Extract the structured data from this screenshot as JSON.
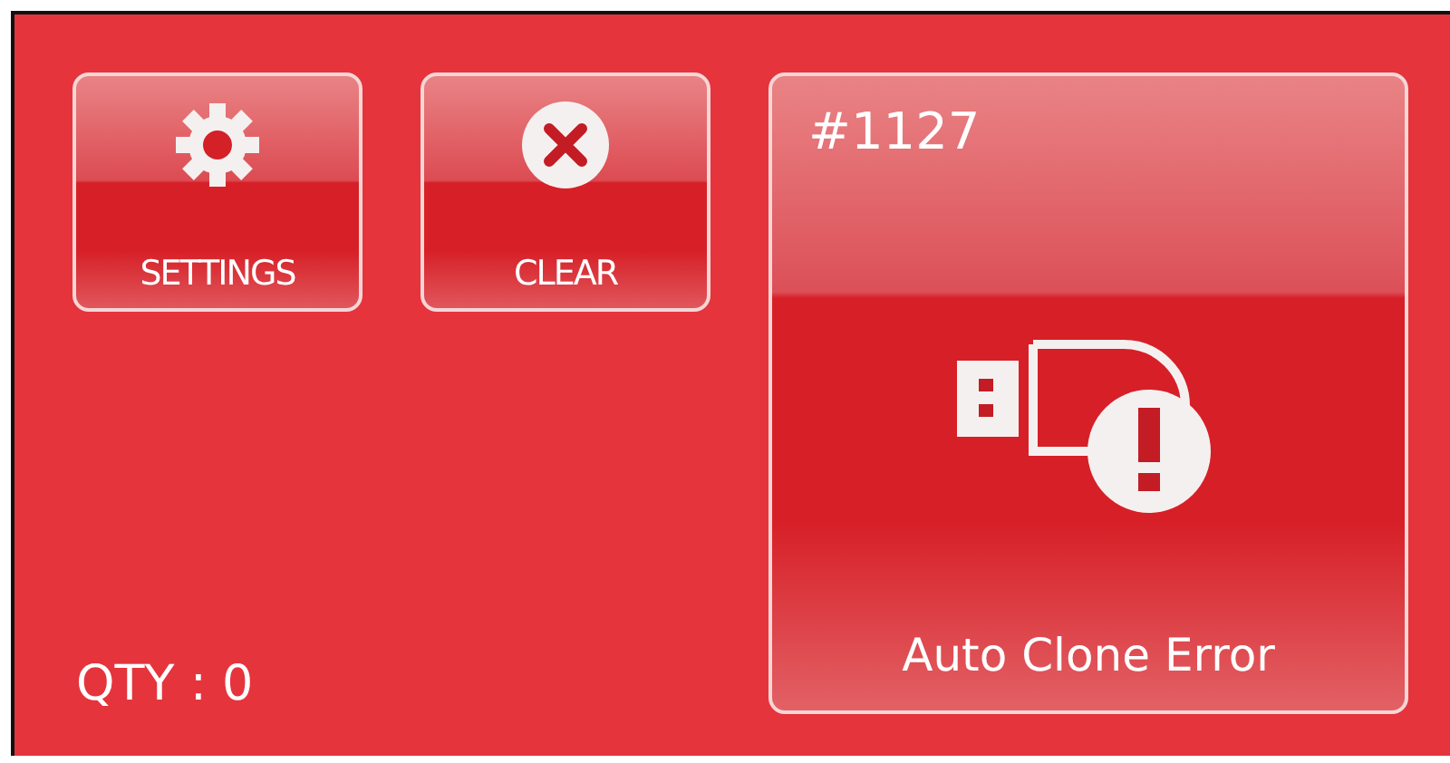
{
  "buttons": [
    {
      "kind": "settings",
      "label": "SETTINGS"
    },
    {
      "kind": "clear",
      "label": "CLEAR"
    }
  ],
  "quantity": "QTY : 0",
  "status_tile": {
    "number": "#1127",
    "kind": "usb-error",
    "message": "Auto Clone Error"
  }
}
